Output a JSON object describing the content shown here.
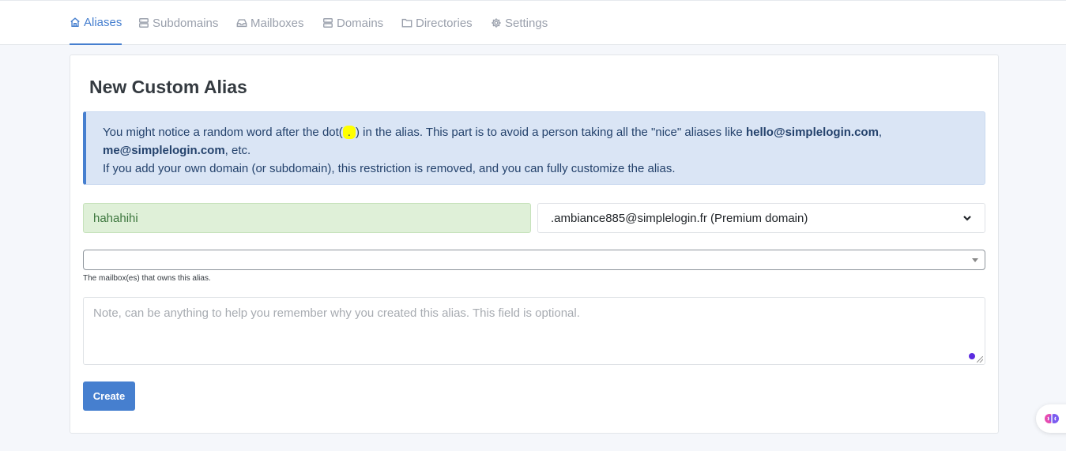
{
  "nav": {
    "items": [
      {
        "label": "Aliases",
        "icon": "home-icon",
        "active": true
      },
      {
        "label": "Subdomains",
        "icon": "server-icon"
      },
      {
        "label": "Mailboxes",
        "icon": "inbox-icon"
      },
      {
        "label": "Domains",
        "icon": "server-icon"
      },
      {
        "label": "Directories",
        "icon": "folder-icon"
      },
      {
        "label": "Settings",
        "icon": "gear-icon"
      }
    ]
  },
  "page": {
    "title": "New Custom Alias"
  },
  "alert": {
    "text_before_dot": "You might notice a random word after the dot(",
    "dot": ".",
    "text_after_dot": ") in the alias. This part is to avoid a person taking all the \"nice\" aliases like ",
    "example1": "hello@simplelogin.com",
    "sep": ",",
    "example2": "me@simplelogin.com",
    "etc": ", etc.",
    "line2": "If you add your own domain (or subdomain), this restriction is removed, and you can fully customize the alias."
  },
  "form": {
    "alias_prefix_value": "hahahihi",
    "suffix_value": ".ambiance885@simplelogin.fr (Premium domain)",
    "mailbox_value": "",
    "mailbox_help": "The mailbox(es) that owns this alias.",
    "note_placeholder": "Note, can be anything to help you remember why you created this alias. This field is optional.",
    "create_label": "Create"
  },
  "colors": {
    "accent": "#467fcf",
    "alert_bg": "#dae5f5",
    "valid_bg": "#dff0d8",
    "highlight": "#ffff00"
  }
}
